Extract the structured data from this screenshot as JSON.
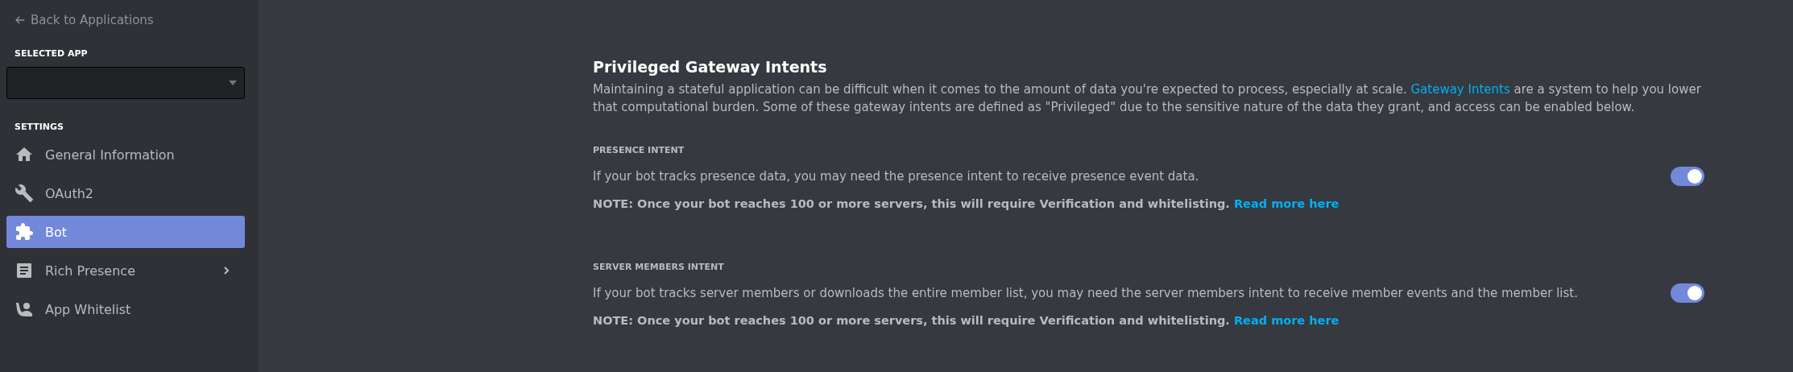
{
  "sidebar": {
    "back_link": "Back to Applications",
    "selected_app_label": "SELECTED APP",
    "settings_label": "SETTINGS",
    "items": [
      {
        "label": "General Information",
        "selected": false
      },
      {
        "label": "OAuth2",
        "selected": false
      },
      {
        "label": "Bot",
        "selected": true
      },
      {
        "label": "Rich Presence",
        "selected": false,
        "expanded": false
      },
      {
        "label": "App Whitelist",
        "selected": false
      }
    ]
  },
  "main": {
    "title": "Privileged Gateway Intents",
    "description": {
      "before": "Maintaining a stateful application can be difficult when it comes to the amount of data you're expected to process, especially at scale.",
      "link": "Gateway Intents",
      "after": "are a system to help you lower that computational burden. Some of these gateway intents are defined as \"Privileged\" due to the sensitive nature of the data they grant, and access can be enabled below."
    },
    "intents": [
      {
        "heading": "PRESENCE INTENT",
        "text": "If your bot tracks presence data, you may need the presence intent to receive presence event data.",
        "note": "NOTE: Once your bot reaches 100 or more servers, this will require Verification and whitelisting.",
        "link": "Read more here",
        "on": true
      },
      {
        "heading": "SERVER MEMBERS INTENT",
        "text": "If your bot tracks server members or downloads the entire member list, you may need the server members intent to receive member events and the member list.",
        "note": "NOTE: Once your bot reaches 100 or more servers, this will require Verification and whitelisting.",
        "link": "Read more here",
        "on": true
      }
    ]
  }
}
